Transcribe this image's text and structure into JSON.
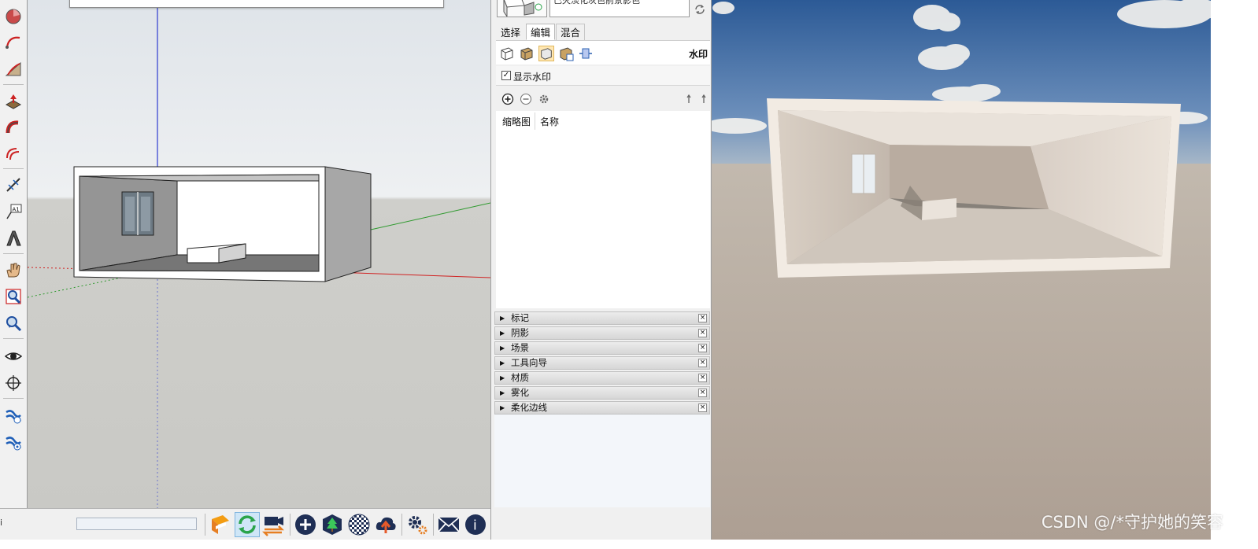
{
  "viewport": {
    "axis_colors": {
      "blue": "#2d3bd0",
      "green": "#2f9a2f",
      "red": "#d02222"
    }
  },
  "left_toolbar": {
    "icons": [
      "pie-icon",
      "arc-icon",
      "freehand-icon",
      "push-pull-icon",
      "follow-me-icon",
      "offset-icon",
      "tape-measure-icon",
      "text-label-icon",
      "3d-text-icon",
      "pan-hand-icon",
      "zoom-icon",
      "zoom-window-icon",
      "look-around-icon",
      "position-camera-icon",
      "plugin-a-icon",
      "plugin-b-icon"
    ],
    "text_tool_label": "A1"
  },
  "status": {
    "glyph": "i",
    "measurements_value": ""
  },
  "bottom_toolbar": {
    "icons": [
      "render-logo-icon",
      "sync-icon",
      "camera-export-icon",
      "add-icon",
      "tree-icon",
      "checker-icon",
      "cloud-upload-icon",
      "settings-icon",
      "mail-icon",
      "info-icon"
    ],
    "info_glyph": "i"
  },
  "tray": {
    "style_description": "已灭淡化灰色前景影色",
    "tabs": [
      "选择",
      "编辑",
      "混合"
    ],
    "active_tab": "编辑",
    "edit_section_title": "水印",
    "show_watermark_label": "显示水印",
    "show_watermark_checked": true,
    "watermark_list_columns": [
      "缩略图",
      "名称"
    ],
    "collapsed_panels": [
      "标记",
      "阴影",
      "场景",
      "工具向导",
      "材质",
      "雾化",
      "柔化边线"
    ]
  },
  "render_view": {
    "sky_color": "#3f6ea8",
    "ground_color": "#b3a79d"
  },
  "watermark_text": "CSDN @/*守护她的笑容"
}
